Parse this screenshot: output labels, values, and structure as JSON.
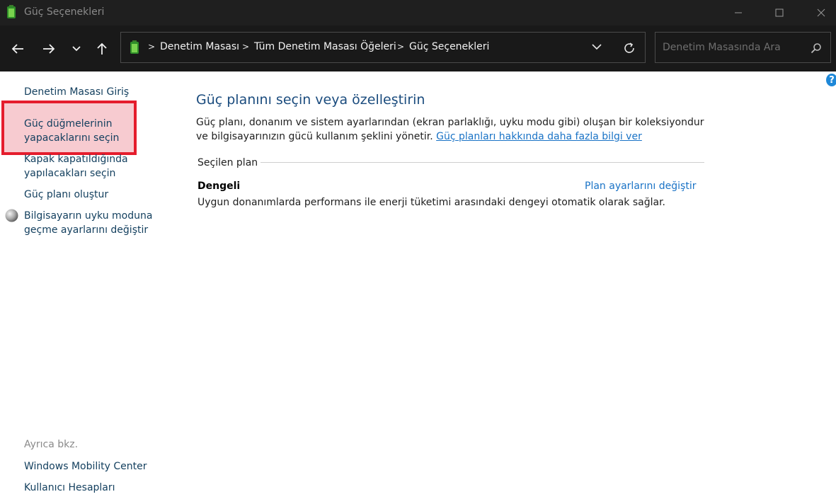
{
  "window": {
    "title": "Güç Seçenekleri"
  },
  "address": {
    "crumbs": [
      "Denetim Masası",
      "Tüm Denetim Masası Öğeleri",
      "Güç Seçenekleri"
    ]
  },
  "search": {
    "placeholder": "Denetim Masasında Ara"
  },
  "help": {
    "label": "?"
  },
  "sidebar": {
    "home": "Denetim Masası Giriş",
    "items": [
      {
        "line1": "Güç düğmelerinin",
        "line2": "yapacaklarını seçin"
      },
      {
        "line1": "Kapak kapatıldığında",
        "line2": "yapılacakları seçin"
      },
      {
        "line1": "Güç planı oluştur"
      },
      {
        "line1": "Bilgisayarın uyku moduna",
        "line2": "geçme ayarlarını değiştir"
      }
    ],
    "see_also_label": "Ayrıca bkz.",
    "see_also": [
      "Windows Mobility Center",
      "Kullanıcı Hesapları"
    ]
  },
  "main": {
    "title": "Güç planını seçin veya özelleştirin",
    "desc_text": "Güç planı, donanım ve sistem ayarlarından (ekran parlaklığı, uyku modu gibi) oluşan bir koleksiyondur ve bilgisayarınızın gücü kullanım şeklini yönetir. ",
    "desc_link": "Güç planları hakkında daha fazla bilgi ver",
    "section_label": "Seçilen plan",
    "plan_name": "Dengeli",
    "plan_link": "Plan ayarlarını değiştir",
    "plan_desc": "Uygun donanımlarda performans ile enerji tüketimi arasındaki dengeyi otomatik olarak sağlar."
  },
  "colors": {
    "titlebar": "#1f1f1f",
    "navbar": "#191919",
    "link": "#1a73c6",
    "heading": "#1b4c7e",
    "highlight_border": "#e51d2d"
  }
}
